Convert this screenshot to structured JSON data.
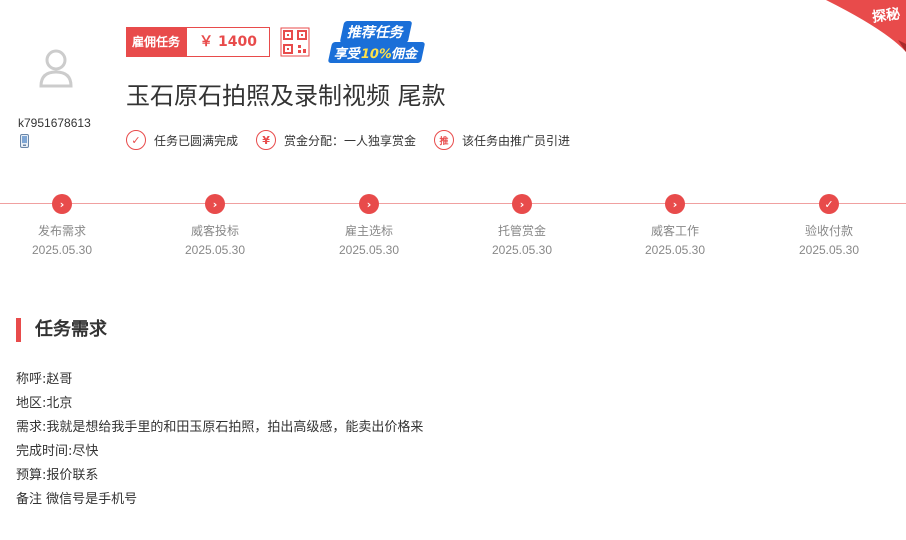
{
  "corner_badge": "探秘",
  "user": {
    "name": "k7951678613",
    "avatar_icon": "user-icon",
    "phone_icon": "phone-icon"
  },
  "task": {
    "type_label": "雇佣任务",
    "price": "￥ 1400",
    "title": "玉石原石拍照及录制视频 尾款"
  },
  "promo": {
    "line1": "推荐任务",
    "line2_prefix": "享受",
    "line2_highlight": "10%",
    "line2_suffix": "佣金"
  },
  "features": [
    {
      "icon": "check-circle-icon",
      "glyph": "✓",
      "text": "任务已圆满完成"
    },
    {
      "icon": "yen-circle-icon",
      "glyph": "¥",
      "text": "赏金分配：一人独享赏金"
    },
    {
      "icon": "promote-circle-icon",
      "glyph": "推",
      "text": "该任务由推广员引进"
    }
  ],
  "steps": [
    {
      "label": "发布需求",
      "date": "2025.05.30",
      "glyph": "›"
    },
    {
      "label": "威客投标",
      "date": "2025.05.30",
      "glyph": "›"
    },
    {
      "label": "雇主选标",
      "date": "2025.05.30",
      "glyph": "›"
    },
    {
      "label": "托管赏金",
      "date": "2025.05.30",
      "glyph": "›"
    },
    {
      "label": "威客工作",
      "date": "2025.05.30",
      "glyph": "›"
    },
    {
      "label": "验收付款",
      "date": "2025.05.30",
      "glyph": "✓"
    }
  ],
  "section": {
    "title": "任务需求",
    "lines": [
      "称呼:赵哥",
      "地区:北京",
      "需求:我就是想给我手里的和田玉原石拍照，拍出高级感，能卖出价格来",
      "完成时间:尽快",
      "预算:报价联系",
      "备注 微信号是手机号"
    ]
  },
  "colors": {
    "accent": "#e84b4b",
    "promo_blue": "#1a6fd8",
    "promo_yellow": "#ffe14a"
  }
}
